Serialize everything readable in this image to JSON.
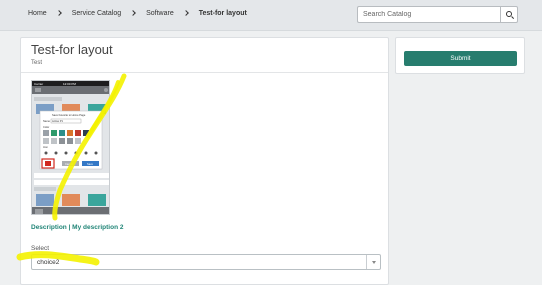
{
  "breadcrumb": {
    "items": [
      "Home",
      "Service Catalog",
      "Software",
      "Test-for layout"
    ]
  },
  "search": {
    "placeholder": "Search Catalog",
    "icon": "search-icon"
  },
  "item": {
    "title": "Test-for layout",
    "subtitle": "Test",
    "description_link": "Description | My description 2",
    "select_label": "Select",
    "select_value": "choice2"
  },
  "sidebar": {
    "submit_label": "Submit"
  },
  "phone_screenshot": {
    "status_carrier": "Carrier",
    "status_time": "12:00 PM",
    "dialog_title": "Save Favorite to Home Page",
    "name_label": "Name",
    "name_value": "Active P1",
    "color_label": "Color",
    "icon_label": "Icon",
    "cancel_label": "Cancel",
    "save_label": "Save"
  },
  "colors": {
    "accent": "#277d6e",
    "link": "#1f8476",
    "highlighter": "#f4f200"
  }
}
